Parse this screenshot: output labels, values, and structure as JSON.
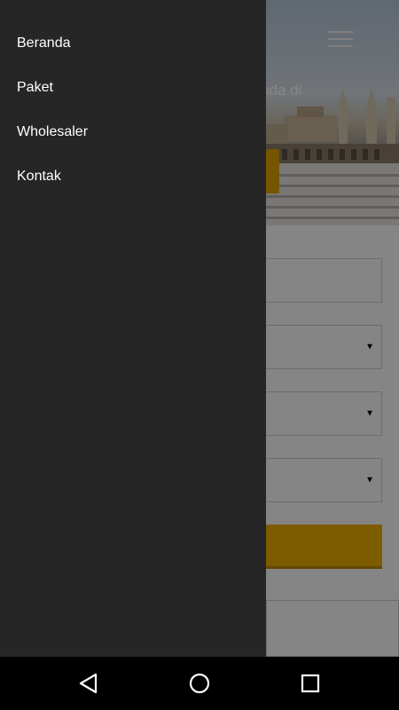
{
  "hero": {
    "text_fragment": "an Anda di"
  },
  "drawer": {
    "items": [
      {
        "label": "Beranda"
      },
      {
        "label": "Paket"
      },
      {
        "label": "Wholesaler"
      },
      {
        "label": "Kontak"
      }
    ]
  },
  "form": {
    "dropdown_caret": "▼"
  },
  "colors": {
    "drawer_background": "#262626",
    "accent_gold": "#f0b000",
    "scrim": "rgba(0,0,0,0.48)",
    "navbar": "#000000"
  },
  "icons": {
    "menu": "hamburger-menu-icon",
    "back": "back-triangle-icon",
    "home": "home-circle-icon",
    "recents": "recents-square-icon"
  }
}
